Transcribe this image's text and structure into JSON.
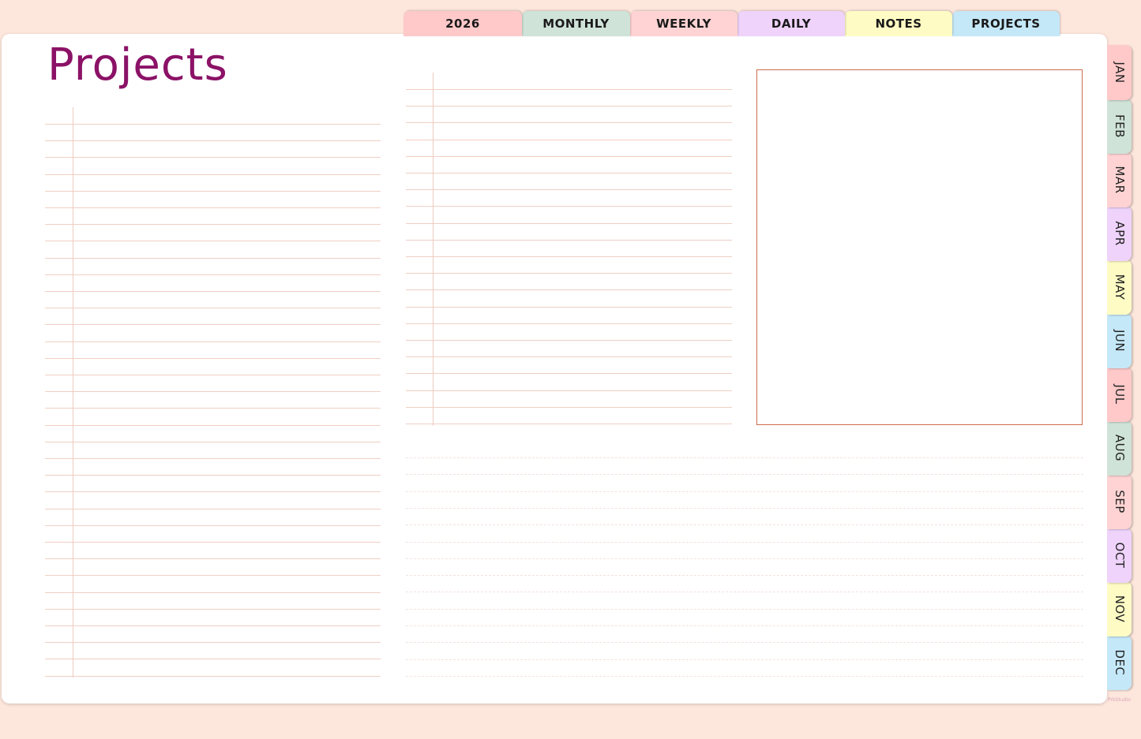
{
  "top_tabs": [
    {
      "label": "2026",
      "color": "#ffc9c9"
    },
    {
      "label": "MONTHLY",
      "color": "#cfe3d8"
    },
    {
      "label": "WEEKLY",
      "color": "#ffd3d3"
    },
    {
      "label": "DAILY",
      "color": "#efd3fb"
    },
    {
      "label": "NOTES",
      "color": "#fefcc4"
    },
    {
      "label": "PROJECTS",
      "color": "#c5e8f8"
    }
  ],
  "page": {
    "title": "Projects",
    "title_color": "#8b1266",
    "credit": "PrbStudio"
  },
  "colors": {
    "background": "#fde6dc",
    "line": "#f0cfc4",
    "box_border": "#cf6b4f"
  },
  "month_tabs": [
    {
      "label": "JAN",
      "color": "#ffc9c9"
    },
    {
      "label": "FEB",
      "color": "#cfe3d8"
    },
    {
      "label": "MAR",
      "color": "#ffd3d3"
    },
    {
      "label": "APR",
      "color": "#efd3fb"
    },
    {
      "label": "MAY",
      "color": "#fefcc4"
    },
    {
      "label": "JUN",
      "color": "#c5e8f8"
    },
    {
      "label": "JUL",
      "color": "#ffc9c9"
    },
    {
      "label": "AUG",
      "color": "#cfe3d8"
    },
    {
      "label": "SEP",
      "color": "#ffd3d3"
    },
    {
      "label": "OCT",
      "color": "#efd3fb"
    },
    {
      "label": "NOV",
      "color": "#fefcc4"
    },
    {
      "label": "DEC",
      "color": "#c5e8f8"
    }
  ]
}
